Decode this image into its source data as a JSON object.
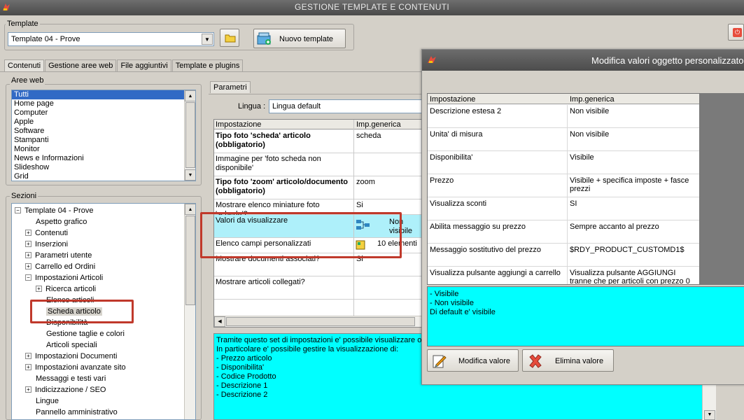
{
  "window": {
    "title": "GESTIONE TEMPLATE E CONTENUTI"
  },
  "template_group": {
    "label": "Template",
    "selected": "Template 04 - Prove",
    "new_button": "Nuovo template"
  },
  "tabs": [
    "Contenuti",
    "Gestione aree web",
    "File aggiuntivi",
    "Template e plugins"
  ],
  "aree_web": {
    "label": "Aree web",
    "items": [
      "Tutti",
      "Home page",
      "Computer",
      "Apple",
      "Software",
      "Stampanti",
      "Monitor",
      "News e Informazioni",
      "Slideshow",
      "Grid"
    ],
    "selected_index": 0
  },
  "sezioni": {
    "label": "Sezioni",
    "nodes": [
      {
        "label": "Template 04 - Prove",
        "level": 0,
        "exp": "−"
      },
      {
        "label": "Aspetto grafico",
        "level": 1,
        "exp": ""
      },
      {
        "label": "Contenuti",
        "level": 1,
        "exp": "+"
      },
      {
        "label": "Inserzioni",
        "level": 1,
        "exp": "+"
      },
      {
        "label": "Parametri utente",
        "level": 1,
        "exp": "+"
      },
      {
        "label": "Carrello ed Ordini",
        "level": 1,
        "exp": "+"
      },
      {
        "label": "Impostazioni Articoli",
        "level": 1,
        "exp": "−"
      },
      {
        "label": "Ricerca articoli",
        "level": 2,
        "exp": "+"
      },
      {
        "label": "Elenco articoli",
        "level": 2,
        "exp": ""
      },
      {
        "label": "Scheda articolo",
        "level": 2,
        "exp": "",
        "selected": true
      },
      {
        "label": "Disponibilità",
        "level": 2,
        "exp": ""
      },
      {
        "label": "Gestione taglie e colori",
        "level": 2,
        "exp": ""
      },
      {
        "label": "Articoli speciali",
        "level": 2,
        "exp": ""
      },
      {
        "label": "Impostazioni Documenti",
        "level": 1,
        "exp": "+"
      },
      {
        "label": "Impostazioni avanzate sito",
        "level": 1,
        "exp": "+"
      },
      {
        "label": "Messaggi e testi vari",
        "level": 1,
        "exp": ""
      },
      {
        "label": "Indicizzazione / SEO",
        "level": 1,
        "exp": "+"
      },
      {
        "label": "Lingue",
        "level": 1,
        "exp": ""
      },
      {
        "label": "Pannello amministrativo",
        "level": 1,
        "exp": ""
      }
    ]
  },
  "parametri": {
    "tab_label": "Parametri",
    "lingua_label": "Lingua :",
    "lingua_value": "Lingua default",
    "col_impostazione": "Impostazione",
    "col_generica": "Imp.generica",
    "rows": [
      {
        "name": "Tipo foto 'scheda' articolo (obbligatorio)",
        "value": "scheda",
        "bold": true
      },
      {
        "name": "Immagine per 'foto scheda non disponibile'",
        "value": "",
        "bold": false
      },
      {
        "name": "Tipo foto 'zoom' articolo/documento (obbligatorio)",
        "value": "zoom",
        "bold": true
      },
      {
        "name": "Mostrare elenco miniature foto 'scheda'?",
        "value": "Si",
        "bold": false
      },
      {
        "name": "Valori da visualizzare",
        "value": "Non visibile",
        "bold": false,
        "highlight": true
      },
      {
        "name": "Elenco campi personalizzati",
        "value": "10 elementi",
        "bold": false
      },
      {
        "name": "Mostrare documenti associati?",
        "value": "Si",
        "bold": false
      },
      {
        "name": "Mostrare articoli collegati?",
        "value": "",
        "bold": false
      }
    ],
    "description": [
      "Tramite questo set di impostazioni e' possibile visualizzare o me",
      "In particolare e' possibile gestire la visualizzazione di:",
      "- Prezzo articolo",
      "- Disponibilita'",
      "- Codice Prodotto",
      "- Descrizione 1",
      "- Descrizione 2"
    ]
  },
  "dialog": {
    "title": "Modifica valori oggetto personalizzato",
    "col_impostazione": "Impostazione",
    "col_generica": "Imp.generica",
    "rows": [
      {
        "name": "Descrizione estesa 2",
        "value": "Non visibile"
      },
      {
        "name": "Unita' di misura",
        "value": "Non visibile"
      },
      {
        "name": "Disponibilita'",
        "value": "Visibile"
      },
      {
        "name": "Prezzo",
        "value": "Visibile + specifica imposte + fasce prezzi"
      },
      {
        "name": "Visualizza sconti",
        "value": "SI"
      },
      {
        "name": "Abilita messaggio su prezzo",
        "value": "Sempre accanto al prezzo"
      },
      {
        "name": "Messaggio sostitutivo del prezzo",
        "value": "$RDY_PRODUCT_CUSTOMD1$"
      },
      {
        "name": "Visualizza pulsante aggiungi a carrello",
        "value": "Visualizza pulsante AGGIUNGI tranne che per articoli con prezzo 0"
      }
    ],
    "hint": [
      "- Visibile",
      "- Non visibile",
      "Di default e' visibile"
    ],
    "modify_button": "Modifica valore",
    "delete_button": "Elimina valore"
  },
  "colors": {
    "highlight": "#00ffff",
    "selection": "#316ac5",
    "annotation": "#c0392b"
  }
}
